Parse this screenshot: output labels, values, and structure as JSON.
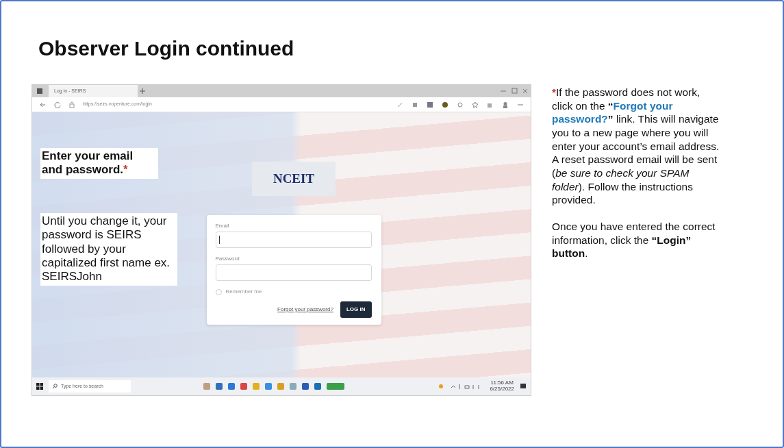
{
  "slide": {
    "title": "Observer Login continued"
  },
  "screenshot": {
    "browser": {
      "tabs": [
        {
          "label": "Log in - SEIRS",
          "selected": true
        }
      ],
      "address": "https://seirs.vopenture.com/login"
    },
    "notes": [
      {
        "kind": "heading",
        "text": "Enter your email and password.",
        "mark": "*"
      },
      {
        "kind": "body",
        "text": "Until you change it, your password is SEIRS followed by your capitalized first name ex. SEIRSJohn"
      }
    ],
    "logo": {
      "text": "NCEIT"
    },
    "login_form": {
      "fields": [
        {
          "label": "Email"
        },
        {
          "label": "Password"
        }
      ],
      "remember": {
        "label": "Remember me",
        "checked": false
      },
      "forgot_link": "Forgot your password?",
      "submit": "LOG IN"
    },
    "taskbar": {
      "search_placeholder": "Type here to search",
      "time": "11:56 AM",
      "date": "6/25/2022"
    }
  },
  "explanation": [
    [
      {
        "kind": "mark",
        "text": "*"
      },
      {
        "kind": "plain",
        "text": "If the password does not work, click on the "
      },
      {
        "kind": "strong",
        "text": "“"
      },
      {
        "kind": "link",
        "text": "Forgot your password?"
      },
      {
        "kind": "strong",
        "text": "”"
      },
      {
        "kind": "plain",
        "text": " link. This will navigate you to a new page where you will enter your account’s email address. A reset password email will be sent ("
      },
      {
        "kind": "italic",
        "text": "be sure to check your SPAM folder"
      },
      {
        "kind": "plain",
        "text": "). Follow the instructions provided."
      }
    ],
    [
      {
        "kind": "plain",
        "text": "Once you have entered the correct information, click the "
      },
      {
        "kind": "strong",
        "text": "“Login” button"
      },
      {
        "kind": "plain",
        "text": "."
      }
    ]
  ]
}
